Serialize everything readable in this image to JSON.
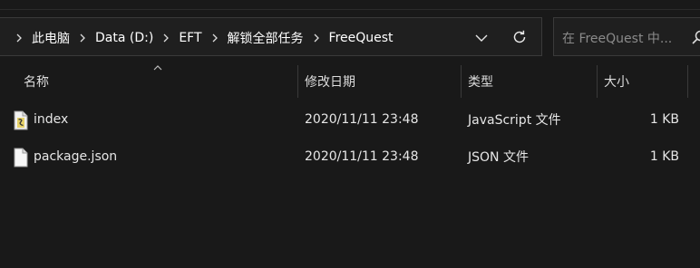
{
  "breadcrumb": [
    {
      "label": "此电脑"
    },
    {
      "label": "Data (D:)"
    },
    {
      "label": "EFT"
    },
    {
      "label": "解锁全部任务"
    },
    {
      "label": "FreeQuest"
    }
  ],
  "search": {
    "placeholder": "在 FreeQuest 中..."
  },
  "columns": {
    "name": "名称",
    "modified": "修改日期",
    "type": "类型",
    "size": "大小"
  },
  "files": [
    {
      "name": "index",
      "modified": "2020/11/11 23:48",
      "type": "JavaScript 文件",
      "size": "1 KB",
      "icon": "javascript-file-icon"
    },
    {
      "name": "package.json",
      "modified": "2020/11/11 23:48",
      "type": "JSON 文件",
      "size": "1 KB",
      "icon": "blank-file-icon"
    }
  ]
}
